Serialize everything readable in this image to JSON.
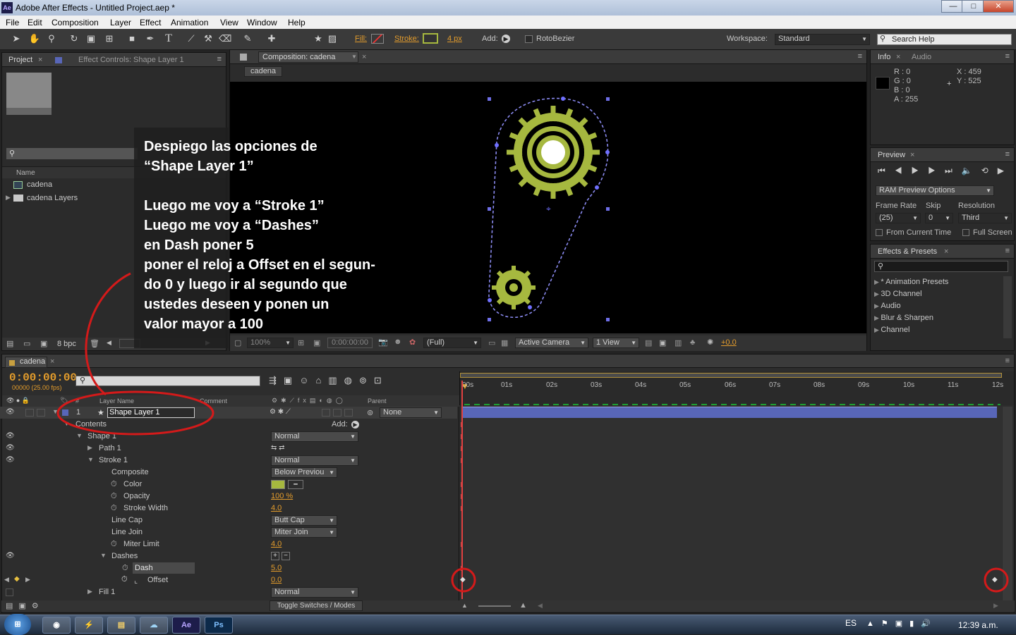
{
  "window": {
    "title": "Adobe After Effects - Untitled Project.aep *",
    "app_icon": "Ae",
    "min": "—",
    "max": "□",
    "close": "✕"
  },
  "menu": [
    "File",
    "Edit",
    "Composition",
    "Layer",
    "Effect",
    "Animation",
    "View",
    "Window",
    "Help"
  ],
  "toolbar": {
    "fill_label": "Fill:",
    "stroke_label": "Stroke:",
    "stroke_width": "4 px",
    "add_label": "Add:",
    "rotobezier": "RotoBezier",
    "workspace_label": "Workspace:",
    "workspace_value": "Standard",
    "search_help": "Search Help"
  },
  "project": {
    "tab_project": "Project",
    "tab_effect": "Effect Controls: Shape Layer 1",
    "name_header": "Name",
    "items": [
      "cadena",
      "cadena Layers"
    ],
    "bpc": "8 bpc"
  },
  "comp": {
    "tab": "Composition: cadena",
    "subtab": "cadena",
    "zoom": "100%",
    "timecode": "0:00:00:00",
    "resolution": "(Full)",
    "camera": "Active Camera",
    "view": "1 View",
    "exposure": "+0.0"
  },
  "info": {
    "tab_info": "Info",
    "tab_audio": "Audio",
    "r": "R : 0",
    "g": "G : 0",
    "b": "B : 0",
    "a": "A : 255",
    "x": "X : 459",
    "y": "Y : 525"
  },
  "preview": {
    "tab": "Preview",
    "ram": "RAM Preview Options",
    "frame_rate_label": "Frame Rate",
    "skip_label": "Skip",
    "resolution_label": "Resolution",
    "frame_rate": "(25)",
    "skip": "0",
    "resolution": "Third",
    "from_current": "From Current Time",
    "full_screen": "Full Screen"
  },
  "effects": {
    "tab": "Effects & Presets",
    "items": [
      "* Animation Presets",
      "3D Channel",
      "Audio",
      "Blur & Sharpen",
      "Channel"
    ]
  },
  "timeline": {
    "tab": "cadena",
    "timecode": "0:00:00:00",
    "fps": "00000 (25.00 fps)",
    "col_layer": "Layer Name",
    "col_comment": "Comment",
    "col_parent": "Parent",
    "layer_num": "1",
    "layer_name": "Shape Layer 1",
    "parent_value": "None",
    "contents": "Contents",
    "add": "Add:",
    "rows": [
      {
        "label": "Shape 1",
        "value": "Normal"
      },
      {
        "label": "Path 1",
        "value": ""
      },
      {
        "label": "Stroke 1",
        "value": "Normal"
      },
      {
        "label": "Composite",
        "value": "Below Previou"
      },
      {
        "label": "Color",
        "value": ""
      },
      {
        "label": "Opacity",
        "value": "100 %"
      },
      {
        "label": "Stroke Width",
        "value": "4.0"
      },
      {
        "label": "Line Cap",
        "value": "Butt Cap"
      },
      {
        "label": "Line Join",
        "value": "Miter Join"
      },
      {
        "label": "Miter Limit",
        "value": "4.0"
      },
      {
        "label": "Dashes",
        "value": ""
      },
      {
        "label": "Dash",
        "value": "5.0"
      },
      {
        "label": "Offset",
        "value": "0.0"
      },
      {
        "label": "Fill 1",
        "value": "Normal"
      }
    ],
    "toggle": "Toggle Switches / Modes",
    "ticks": [
      "00s",
      "01s",
      "02s",
      "03s",
      "04s",
      "05s",
      "06s",
      "07s",
      "08s",
      "09s",
      "10s",
      "11s",
      "12s"
    ]
  },
  "annotation": "Despiego las opciones de\n“Shape Layer 1”\n\nLuego me voy a “Stroke 1”\nLuego me voy a “Dashes”\nen Dash poner 5\nponer el reloj a Offset en el segun-\ndo 0 y luego ir al segundo que\nustedes deseen  y ponen un\nvalor mayor a 100",
  "taskbar": {
    "lang": "ES",
    "time": "12:39 a.m.",
    "apps": [
      "Chrome",
      "Flash",
      "Explorer",
      "Photos",
      "Ae",
      "Ps"
    ]
  },
  "colors": {
    "accent": "#e39c2c",
    "gear": "#a6b83f",
    "annotation_red": "#d41a1a",
    "layer_bar": "#5866b8"
  }
}
